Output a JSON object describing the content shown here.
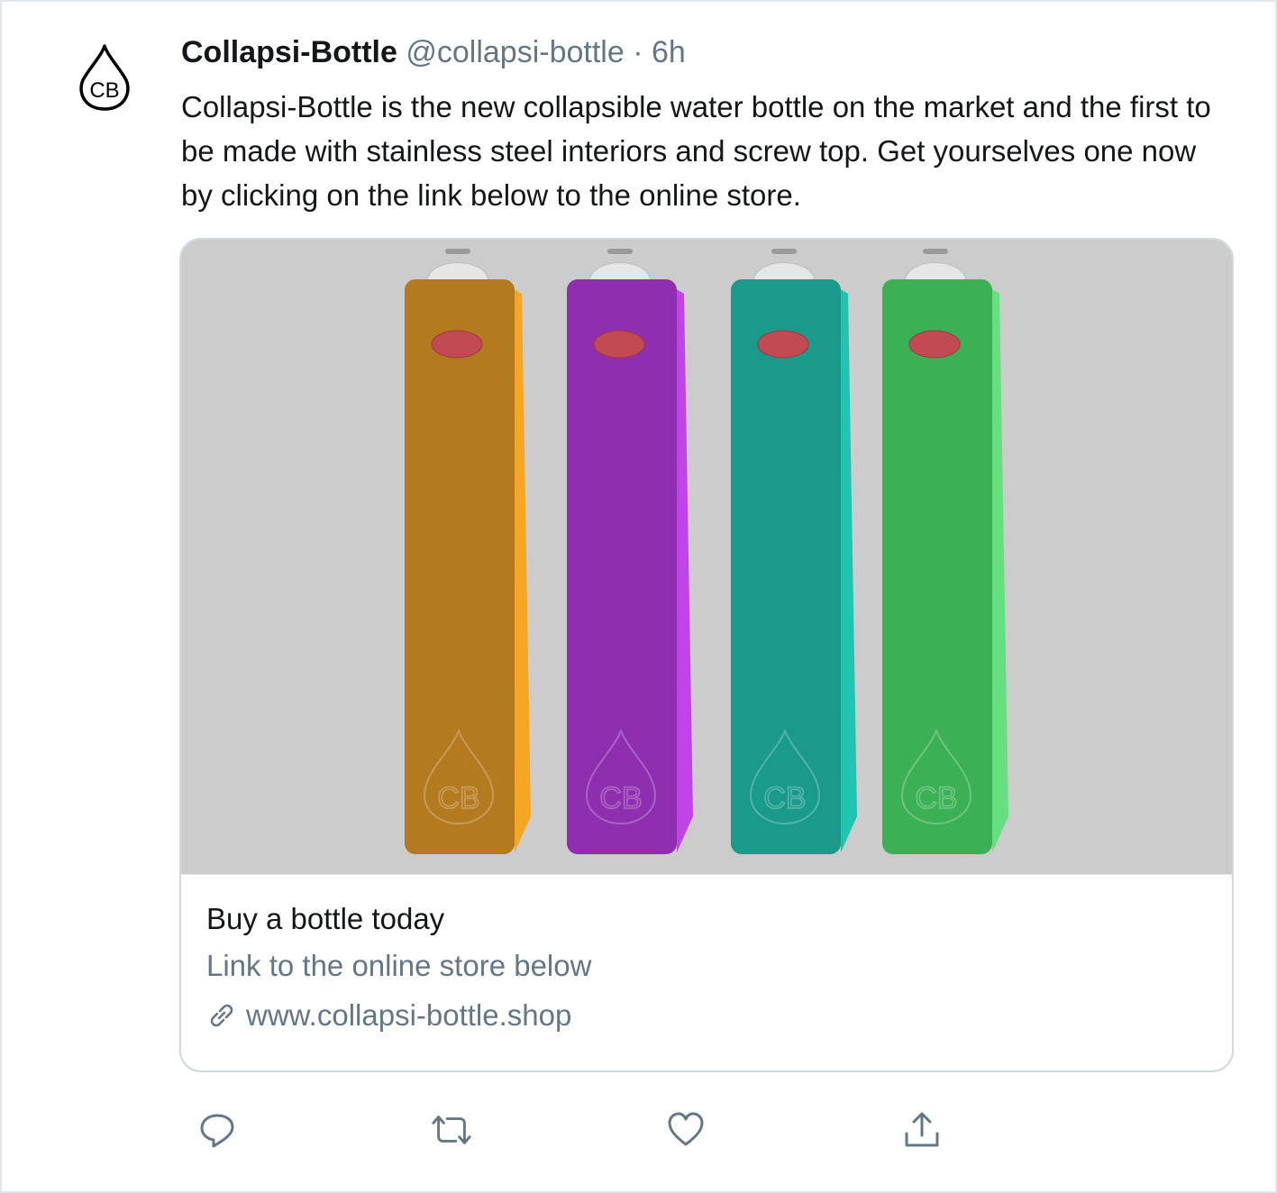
{
  "tweet": {
    "author_name": "Collapsi-Bottle",
    "handle": "@collapsi-bottle",
    "separator": "·",
    "time": "6h",
    "avatar_text": "CB",
    "text": "Collapsi-Bottle is the new collapsible water bottle on the market and the first to be made with stainless steel interiors and screw top. Get yourselves one  now by clicking on the link below to the online store."
  },
  "card": {
    "image_description_icon": "collapsible-bottles-image",
    "bottles": [
      {
        "color": "#b37a20",
        "side_color": "#f5a623",
        "label": "CB"
      },
      {
        "color": "#8e2fb0",
        "side_color": "#c044e8",
        "label": "CB"
      },
      {
        "color": "#1a9a8a",
        "side_color": "#20c4b0",
        "label": "CB"
      },
      {
        "color": "#3cb055",
        "side_color": "#66e07f",
        "label": "CB"
      }
    ],
    "title": "Buy a bottle today",
    "description": "Link to the online store below",
    "url": "www.collapsi-bottle.shop",
    "link_icon": "link-icon"
  },
  "actions": [
    {
      "name": "reply",
      "icon": "reply-icon"
    },
    {
      "name": "retweet",
      "icon": "retweet-icon"
    },
    {
      "name": "like",
      "icon": "heart-icon"
    },
    {
      "name": "share",
      "icon": "share-icon"
    }
  ],
  "colors": {
    "text_primary": "#14171a",
    "text_secondary": "#657786",
    "card_border": "#cfd9de",
    "image_background": "#cccccc"
  }
}
